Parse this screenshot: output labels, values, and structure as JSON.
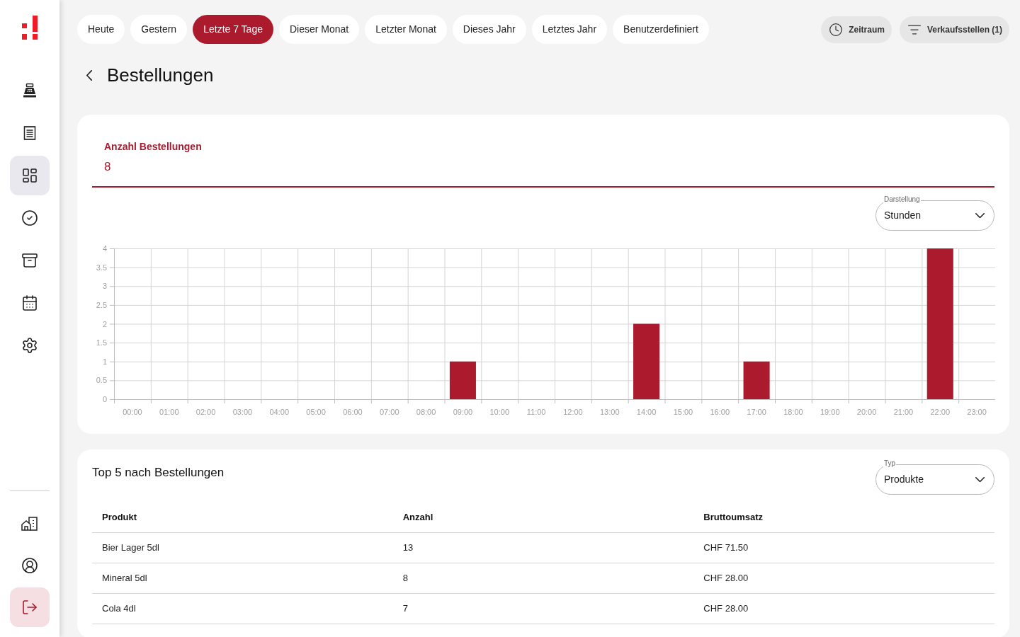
{
  "sidebar": {
    "nav_items": [
      {
        "kind": "register",
        "selected": false
      },
      {
        "kind": "receipt",
        "selected": false
      },
      {
        "kind": "dashboard",
        "selected": true
      },
      {
        "kind": "check",
        "selected": false
      },
      {
        "kind": "archive",
        "selected": false
      },
      {
        "kind": "calendar",
        "selected": false
      },
      {
        "kind": "settings",
        "selected": false
      }
    ],
    "bottom_items": [
      {
        "kind": "building"
      },
      {
        "kind": "user"
      },
      {
        "kind": "logout"
      }
    ]
  },
  "period_tabs": [
    {
      "label": "Heute",
      "selected": false
    },
    {
      "label": "Gestern",
      "selected": false
    },
    {
      "label": "Letzte 7 Tage",
      "selected": true
    },
    {
      "label": "Dieser Monat",
      "selected": false
    },
    {
      "label": "Letzter Monat",
      "selected": false
    },
    {
      "label": "Dieses Jahr",
      "selected": false
    },
    {
      "label": "Letztes Jahr",
      "selected": false
    },
    {
      "label": "Benutzerdefiniert",
      "selected": false
    }
  ],
  "actions": [
    {
      "kind": "time",
      "label": "Zeitraum"
    },
    {
      "kind": "filter",
      "label": "Verkaufsstellen (1)"
    }
  ],
  "page": {
    "title": "Bestellungen"
  },
  "orders_card": {
    "metric_label": "Anzahl Bestellungen",
    "metric_value": "8",
    "display_select": {
      "label": "Darstellung",
      "value": "Stunden"
    },
    "chart_data": {
      "type": "bar",
      "categories": [
        "00:00",
        "01:00",
        "02:00",
        "03:00",
        "04:00",
        "05:00",
        "06:00",
        "07:00",
        "08:00",
        "09:00",
        "10:00",
        "11:00",
        "12:00",
        "13:00",
        "14:00",
        "15:00",
        "16:00",
        "17:00",
        "18:00",
        "19:00",
        "20:00",
        "21:00",
        "22:00",
        "23:00"
      ],
      "values": [
        0,
        0,
        0,
        0,
        0,
        0,
        0,
        0,
        0,
        1,
        0,
        0,
        0,
        0,
        2,
        0,
        0,
        1,
        0,
        0,
        0,
        0,
        4,
        0
      ],
      "ylim": [
        0,
        4
      ],
      "yticks": [
        0,
        0.5,
        1,
        1.5,
        2,
        2.5,
        3,
        3.5,
        4
      ],
      "grid": true
    }
  },
  "top_card": {
    "title": "Top 5 nach Bestellungen",
    "type_select": {
      "label": "Typ",
      "value": "Produkte"
    },
    "table": {
      "columns": [
        "Produkt",
        "Anzahl",
        "Bruttoumsatz"
      ],
      "rows": [
        [
          "Bier Lager 5dl",
          "13",
          "CHF 71.50"
        ],
        [
          "Mineral 5dl",
          "8",
          "CHF 28.00"
        ],
        [
          "Cola 4dl",
          "7",
          "CHF 28.00"
        ]
      ]
    }
  }
}
